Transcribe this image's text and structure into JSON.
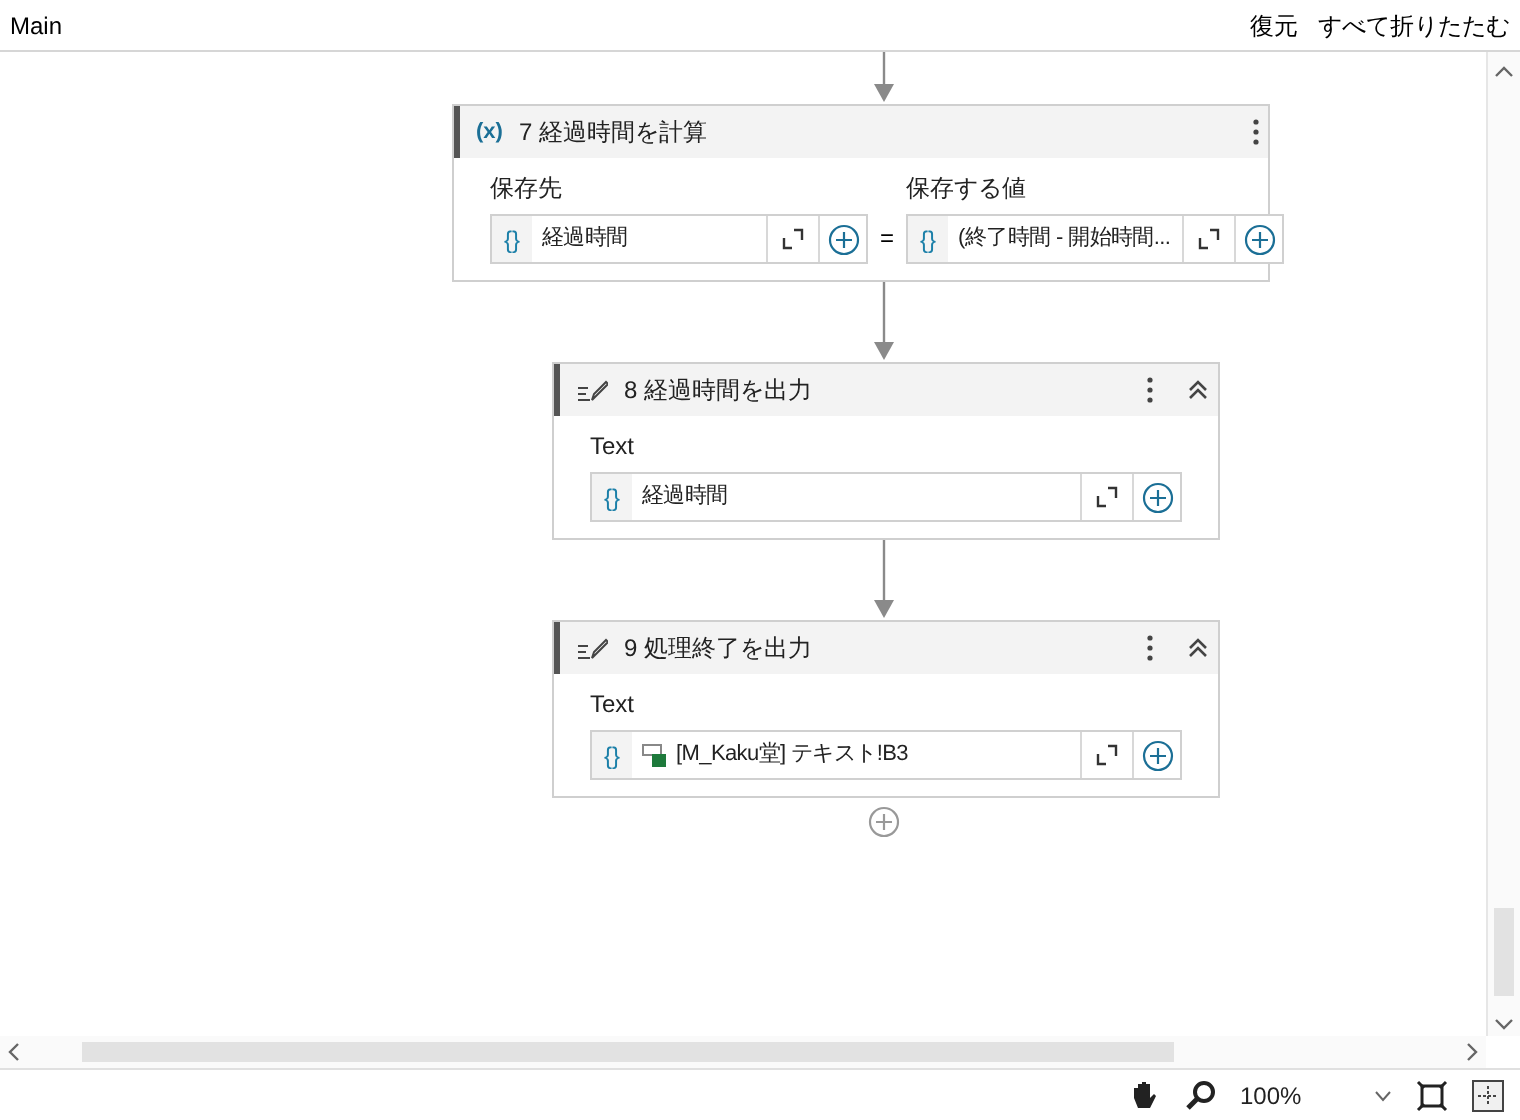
{
  "tab": {
    "title": "Main"
  },
  "header_actions": [
    "復元",
    "すべて折りたたむ"
  ],
  "actions": [
    {
      "kind": "set_variable",
      "icon": "(x)",
      "title": "7 経過時間を計算",
      "collapsible": false,
      "operator": "=",
      "fields": [
        {
          "label": "保存先",
          "icon": "{}",
          "kind": "variable",
          "value": "経過時間"
        },
        {
          "label": "保存する値",
          "icon": "{}",
          "kind": "variable",
          "value": "(終了時間 - 開始時間..."
        }
      ]
    },
    {
      "kind": "output",
      "title": "8 経過時間を出力",
      "collapsible": true,
      "fields": [
        {
          "label": "Text",
          "icon": "{}",
          "kind": "variable",
          "value": "経過時間"
        }
      ]
    },
    {
      "kind": "output",
      "title": "9 処理終了を出力",
      "collapsible": true,
      "fields": [
        {
          "label": "Text",
          "icon": "{}",
          "kind": "excel_reference",
          "value": "[M_Kaku堂] テキスト!B3"
        }
      ]
    }
  ],
  "zoom": {
    "value": "100%"
  }
}
